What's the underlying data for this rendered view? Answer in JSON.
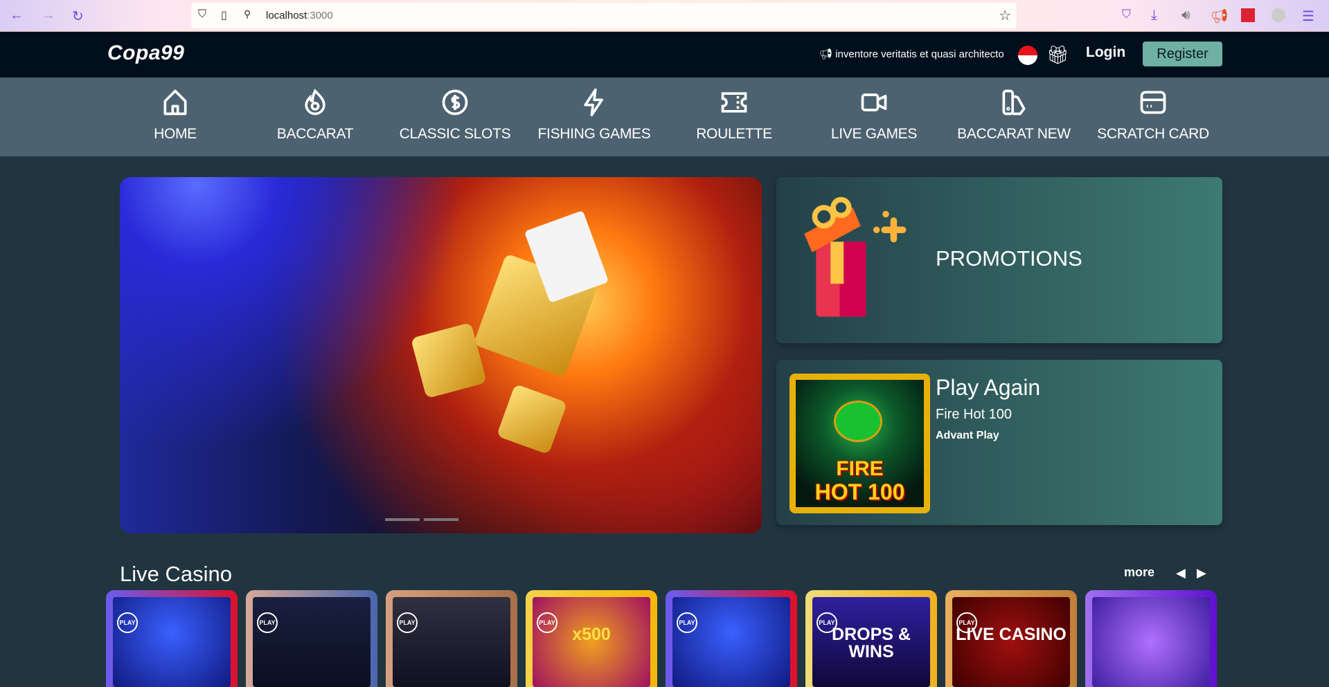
{
  "browser": {
    "url_host": "localhost",
    "url_port": ":3000",
    "icons": [
      "back-icon",
      "forward-icon",
      "reload-icon",
      "shield-icon",
      "page-icon",
      "permissions-icon",
      "bookmark-star-icon",
      "pocket-icon",
      "download-icon",
      "speaker-icon",
      "megaphone-icon",
      "extension-icon",
      "profile-icon",
      "menu-icon"
    ]
  },
  "header": {
    "logo": "Copa99",
    "announcement": "inventore veritatis et quasi architecto",
    "login": "Login",
    "register": "Register",
    "colors": {
      "register_bg": "#6fb0a4",
      "header_bg": "#010f1c"
    }
  },
  "nav": {
    "items": [
      {
        "label": "HOME",
        "icon": "home-icon"
      },
      {
        "label": "BACCARAT",
        "icon": "fire-icon"
      },
      {
        "label": "CLASSIC SLOTS",
        "icon": "dollar-coin-icon"
      },
      {
        "label": "FISHING GAMES",
        "icon": "lightning-icon"
      },
      {
        "label": "ROULETTE",
        "icon": "ticket-icon"
      },
      {
        "label": "LIVE GAMES",
        "icon": "video-camera-icon"
      },
      {
        "label": "BACCARAT NEW",
        "icon": "swatch-icon"
      },
      {
        "label": "SCRATCH CARD",
        "icon": "card-icon"
      }
    ]
  },
  "promotions": {
    "title": "PROMOTIONS"
  },
  "play_again": {
    "title": "Play Again",
    "game": "Fire Hot 100",
    "provider": "Advant Play",
    "thumb_line1": "FIRE",
    "thumb_line2": "HOT 100"
  },
  "banner": {
    "slides": 2,
    "active_slide": 1
  },
  "live_casino": {
    "title": "Live Casino",
    "more": "more",
    "prev": "◀",
    "next": "▶",
    "cards": [
      {
        "badge": "PLAY",
        "text": "",
        "colors": [
          "#6a5cf0",
          "#e0102a"
        ]
      },
      {
        "badge": "PLAY",
        "text": "",
        "colors": [
          "#d9a898",
          "#4a66b0"
        ]
      },
      {
        "badge": "PLAY",
        "text": "",
        "colors": [
          "#d6a080",
          "#a87048"
        ]
      },
      {
        "badge": "PLAY",
        "text": "x500",
        "colors": [
          "#f5d24a",
          "#f2b80a"
        ]
      },
      {
        "badge": "PLAY",
        "text": "",
        "colors": [
          "#6a5cf0",
          "#e0102a"
        ]
      },
      {
        "badge": "PLAY",
        "text": "DROPS & WINS",
        "colors": [
          "#f0dc78",
          "#f0b020"
        ]
      },
      {
        "badge": "PLAY",
        "text": "LIVE CASINO",
        "colors": [
          "#e8b060",
          "#c08038"
        ]
      },
      {
        "badge": "",
        "text": "",
        "colors": [
          "#a070f0",
          "#6010d0"
        ]
      }
    ]
  }
}
